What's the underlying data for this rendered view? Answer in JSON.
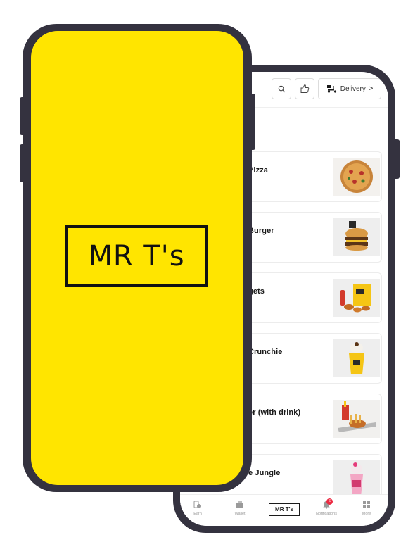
{
  "brand": {
    "name": "MR T's",
    "color": "#ffe500"
  },
  "topbar": {
    "delivery_label": "Delivery",
    "delivery_chevron": ">",
    "icons": [
      "search-icon",
      "thumbs-up-icon",
      "delivery-scooter-icon"
    ]
  },
  "menu": {
    "items": [
      {
        "label": "Pizza",
        "thumb": "pizza"
      },
      {
        "label": "Burger",
        "thumb": "burger"
      },
      {
        "label": "gets",
        "thumb": "nuggets-meal"
      },
      {
        "label": "Crunchie",
        "thumb": "crunchie-shake"
      },
      {
        "label": "er (with drink)",
        "thumb": "meal-with-drink"
      },
      {
        "label": "e Jungle",
        "thumb": "jungle-shake"
      }
    ]
  },
  "bottom_nav": {
    "items": [
      {
        "label": "Earn",
        "icon": "coins-icon"
      },
      {
        "label": "Wallet",
        "icon": "wallet-icon"
      },
      {
        "label": "MR T's",
        "icon": "logo"
      },
      {
        "label": "Notifications",
        "icon": "bell-icon",
        "badge": "6"
      },
      {
        "label": "More",
        "icon": "grid-icon"
      }
    ]
  }
}
